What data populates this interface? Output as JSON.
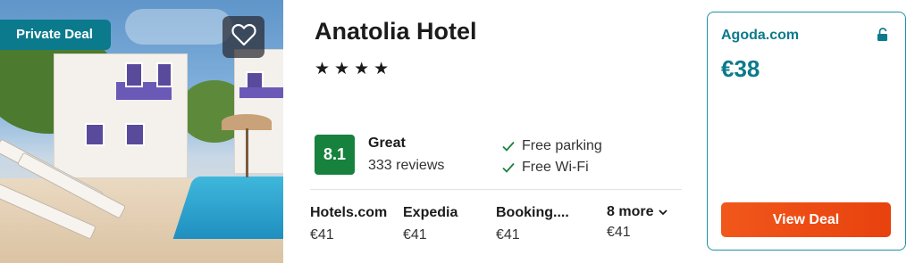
{
  "badge": {
    "label": "Private Deal"
  },
  "favorite": {
    "icon": "heart-outline-icon"
  },
  "hotel": {
    "name": "Anatolia Hotel",
    "stars": "★★★★",
    "star_count": 4
  },
  "rating": {
    "score": "8.1",
    "label": "Great",
    "reviews": "333 reviews",
    "color": "#17823d"
  },
  "amenities": [
    {
      "icon": "checkmark-icon",
      "label": "Free parking"
    },
    {
      "icon": "checkmark-icon",
      "label": "Free Wi-Fi"
    }
  ],
  "providers": [
    {
      "name": "Hotels.com",
      "price": "€41"
    },
    {
      "name": "Expedia",
      "price": "€41"
    },
    {
      "name": "Booking....",
      "price": "€41"
    }
  ],
  "more_deals": {
    "label": "8 more",
    "price": "€41",
    "icon": "chevron-down-icon"
  },
  "deal": {
    "provider": "Agoda.com",
    "price": "€38",
    "lock_icon": "unlock-icon",
    "button_label": "View Deal",
    "accent": "#0b7a8c",
    "button_color": "#f1571b"
  }
}
